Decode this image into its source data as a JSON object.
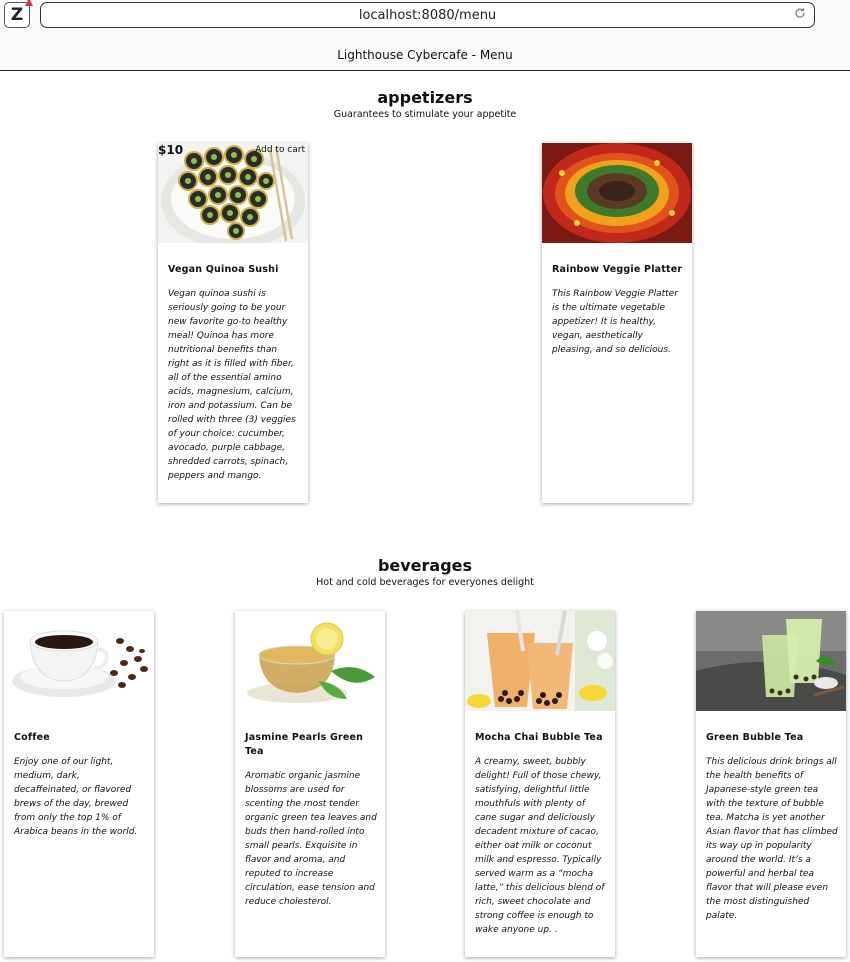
{
  "browser": {
    "url": "localhost:8080/menu",
    "tab_title": "Lighthouse Cybercafe - Menu"
  },
  "sections": [
    {
      "title": "appetizers",
      "subtitle": "Guarantees to stimulate your appetite",
      "items": [
        {
          "price": "$10",
          "add_to_cart": "Add to cart",
          "name": "Vegan Quinoa Sushi",
          "description": "Vegan quinoa sushi is seriously going to be your new favorite go-to healthy meal! Quinoa has more nutritional benefits than right as it is filled with fiber, all of the essential amino acids, magnesium, calcium, iron and potassium. Can be rolled with three (3) veggies of your choice: cucumber, avocado, purple cabbage, shredded carrots, spinach, peppers and mango."
        },
        {
          "name": "Rainbow Veggie Platter",
          "description": "This Rainbow Veggie Platter is the ultimate vegetable appetizer! It is healthy, vegan, aesthetically pleasing, and so delicious."
        }
      ]
    },
    {
      "title": "beverages",
      "subtitle": "Hot and cold beverages for everyones delight",
      "items": [
        {
          "name": "Coffee",
          "description": "Enjoy one of our light, medium, dark, decaffeinated, or flavored brews of the day, brewed from only the top 1% of Arabica beans in the world."
        },
        {
          "name": "Jasmine Pearls Green Tea",
          "description": "Aromatic organic jasmine blossoms are used for scenting the most tender organic green tea leaves and buds then hand-rolled into small pearls. Exquisite in flavor and aroma, and reputed to increase circulation, ease tension and reduce cholesterol."
        },
        {
          "name": "Mocha Chai Bubble Tea",
          "description": "A creamy, sweet, bubbly delight! Full of those chewy, satisfying, delightful little mouthfuls with plenty of cane sugar and deliciously decadent mixture of cacao, either oat milk or coconut milk and espresso. Typically served warm as a “mocha latte,” this delicious blend of rich, sweet chocolate and strong coffee is enough to wake anyone up. ."
        },
        {
          "name": "Green Bubble Tea",
          "description": "This delicious drink brings all the health benefits of Japanese-style green tea with the texture of bubble tea. Matcha is yet another Asian flavor that has climbed its way up in popularity around the world. It’s a powerful and herbal tea flavor that will please even the most distinguished palate."
        }
      ]
    }
  ]
}
